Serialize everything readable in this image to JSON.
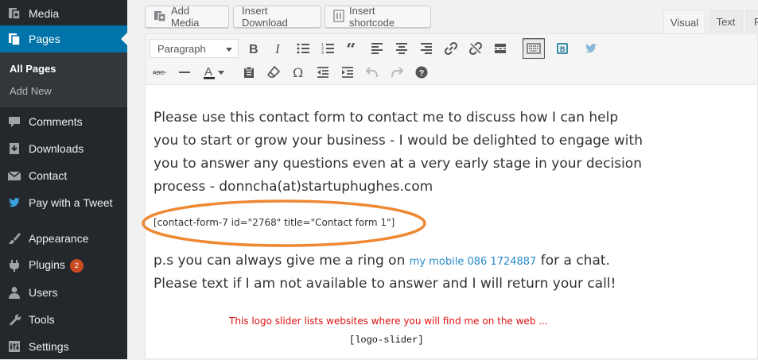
{
  "sidebar": {
    "items": [
      {
        "label": "Media",
        "icon": "media-icon"
      },
      {
        "label": "Pages",
        "icon": "pages-icon"
      },
      {
        "label": "Comments",
        "icon": "comments-icon"
      },
      {
        "label": "Downloads",
        "icon": "downloads-icon"
      },
      {
        "label": "Contact",
        "icon": "mail-icon"
      },
      {
        "label": "Pay with a Tweet",
        "icon": "twitter-icon"
      },
      {
        "label": "Appearance",
        "icon": "brush-icon"
      },
      {
        "label": "Plugins",
        "icon": "plugins-icon",
        "badge": "2"
      },
      {
        "label": "Users",
        "icon": "users-icon"
      },
      {
        "label": "Tools",
        "icon": "wrench-icon"
      },
      {
        "label": "Settings",
        "icon": "settings-icon"
      }
    ],
    "submenu": [
      {
        "label": "All Pages"
      },
      {
        "label": "Add New"
      }
    ]
  },
  "media_buttons": {
    "add_media": "Add Media",
    "insert_download": "Insert Download",
    "insert_shortcode": "Insert shortcode"
  },
  "tabs": {
    "visual": "Visual",
    "text": "Text",
    "third_partial": "P"
  },
  "toolbar": {
    "format_value": "Paragraph"
  },
  "content": {
    "paragraph_lines": [
      "Please use this contact form to contact me to discuss how I can help",
      "you to start or grow your business - I would be delighted to engage with",
      "you to answer any questions even at a very early stage in your decision",
      "process - donncha(at)startuphughes.com"
    ],
    "shortcode": "[contact-form-7 id=\"2768\" title=\"Contact form 1\"]",
    "ps_prefix": "p.s you can always give me a ring on",
    "ps_link": "my mobile 086 1724887",
    "ps_suffix": "for a chat.",
    "ps_line2": "Please text if I am not available to answer and I will return your call!",
    "red_note": "This logo slider lists websites where you will find me on the web ...",
    "logo_shortcode": "[logo-slider]"
  },
  "colors": {
    "sidebar_bg": "#23282d",
    "active": "#0073aa",
    "highlight_ellipse": "#ee8833",
    "link": "#2a8bc9",
    "red_text": "#dd1111"
  }
}
